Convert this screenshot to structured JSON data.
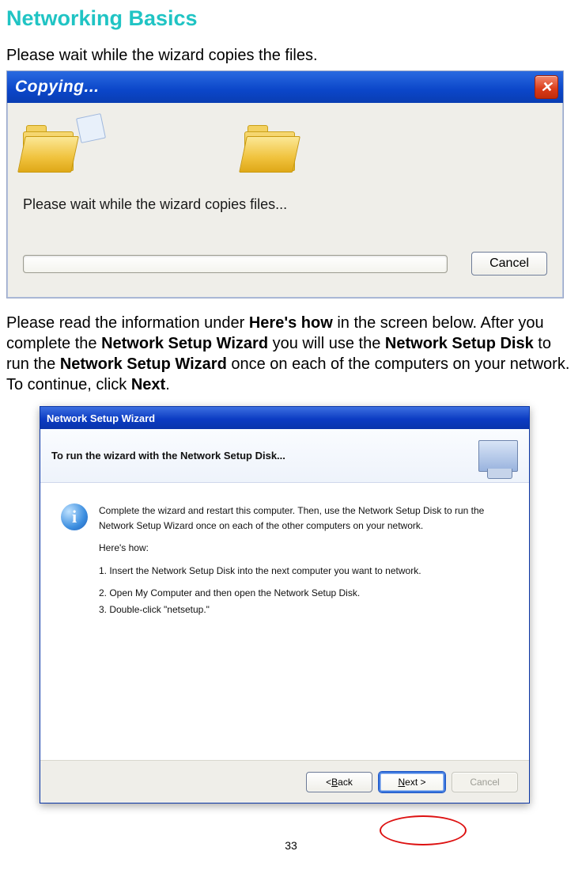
{
  "page": {
    "title": "Networking Basics",
    "instruction1": "Please wait while the wizard copies the files.",
    "instruction2_parts": {
      "p1": "Please read the information under ",
      "b1": "Here's how",
      "p2": " in the screen below. After you complete the ",
      "b2": "Network Setup Wizard",
      "p3": " you will use the ",
      "b3": "Network Setup Disk",
      "p4": " to run the ",
      "b4": "Network Setup Wizard",
      "p5": " once on each of the computers on your network.  To continue, click ",
      "b5": "Next",
      "p6": "."
    },
    "page_number": "33"
  },
  "dialog1": {
    "title": "Copying...",
    "wait_text": "Please wait while the wizard copies files...",
    "cancel_label": "Cancel"
  },
  "dialog2": {
    "title": "Network Setup Wizard",
    "header": "To run the wizard with the Network Setup Disk...",
    "intro": "Complete the wizard and restart this computer. Then, use the Network Setup Disk to run the Network Setup Wizard once on each of the other computers on your network.",
    "hereshow": "Here's how:",
    "step1": "1.  Insert the Network Setup Disk into the next computer you want to network.",
    "step2": "2.  Open My Computer and then open the Network Setup Disk.",
    "step3": "3.  Double-click \"netsetup.\"",
    "back_label_pre": "< ",
    "back_label_u": "B",
    "back_label_post": "ack",
    "next_label_u": "N",
    "next_label_post": "ext >",
    "cancel_label": "Cancel"
  }
}
